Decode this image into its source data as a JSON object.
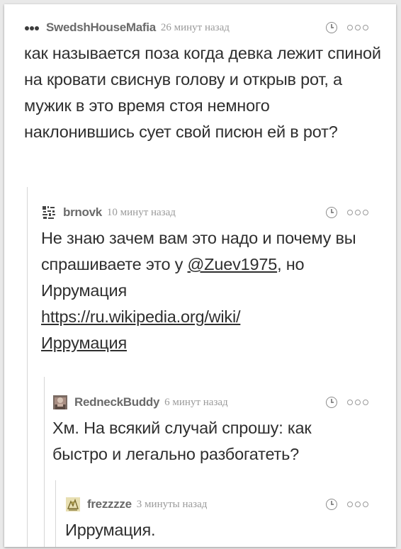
{
  "comments": [
    {
      "username": "SwedshHouseMafia",
      "time": "26 минут назад",
      "avatar_icon": "dots-avatar-icon",
      "text": "как называется поза когда девка лежит спиной на кровати свиснув голову и открыв рот, а мужик в это время стоя немного наклонившись сует свой писюн ей в рот?"
    },
    {
      "username": "brnovk",
      "time": "10 минут назад",
      "avatar_icon": "qr-avatar-icon",
      "text_before": "Не знаю зачем вам это надо и почему вы спрашиваете это у ",
      "mention": "@Zuev1975",
      "text_after": ", но Иррумация",
      "link": "https://ru.wikipedia.org/wiki/Иррумация",
      "link_line1": "https://ru.wikipedia.org/wiki/",
      "link_line2": "Иррумация"
    },
    {
      "username": "RedneckBuddy",
      "time": "6 минут назад",
      "avatar_icon": "photo-avatar-icon",
      "text": "Хм. На всякий случай спрошу: как быстро и легально разбогатеть?"
    },
    {
      "username": "frezzzze",
      "time": "3 минуты назад",
      "avatar_icon": "drawing-avatar-icon",
      "text": "Иррумация."
    }
  ],
  "colors": {
    "username": "#6a6a6a",
    "time": "#9a9a9a",
    "text": "#2f2f2f",
    "thread_line": "#d6d6d6"
  }
}
